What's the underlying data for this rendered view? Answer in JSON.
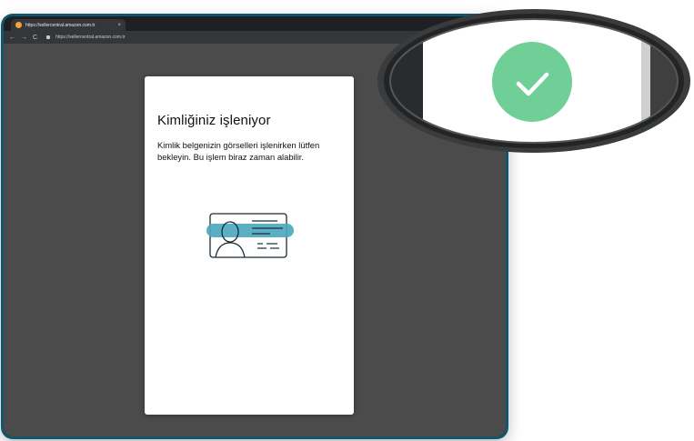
{
  "browser": {
    "tab": {
      "title": "https://sellercentral.amazon.com.tr",
      "close_icon": "×"
    },
    "nav": {
      "back_icon": "←",
      "forward_icon": "→",
      "reload_icon": "C"
    },
    "url": "https://sellercentral.amazon.com.tr"
  },
  "dialog": {
    "title": "Kimliğiniz işleniyor",
    "message": "Kimlik belgenizin görselleri işlenirken lütfen bekleyin. Bu işlem biraz zaman alabilir."
  },
  "colors": {
    "accent_teal": "#4da8bf",
    "success_green": "#6fcf97",
    "page_gray": "#4b4b4c",
    "frame_blue": "#12566e"
  },
  "icons": {
    "id_card": "id-card-icon",
    "success": "checkmark-icon"
  }
}
